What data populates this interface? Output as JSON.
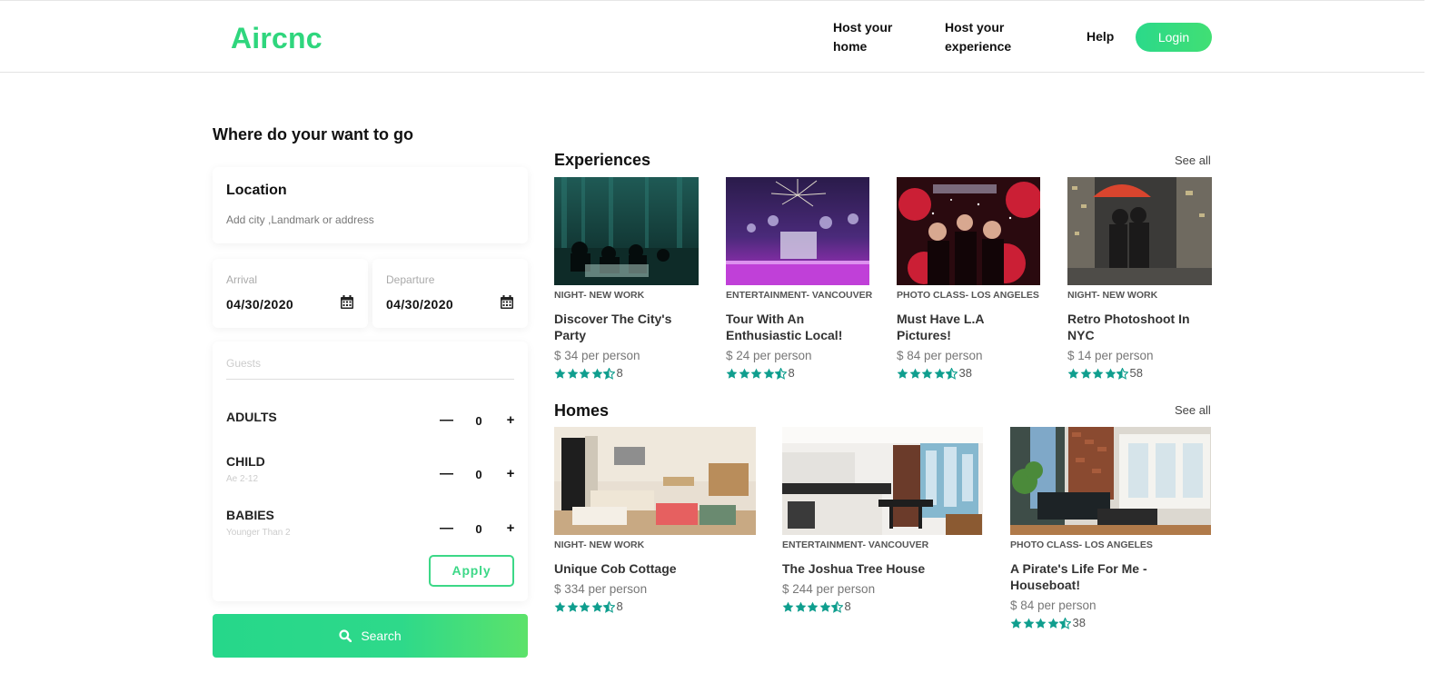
{
  "header": {
    "logo": "Aircnc",
    "nav": {
      "host_home": "Host your home",
      "host_experience": "Host your experience",
      "help": "Help"
    },
    "login": "Login"
  },
  "search_panel": {
    "title": "Where do your want to go",
    "location": {
      "label": "Location",
      "placeholder": "Add city ,Landmark or address"
    },
    "arrival": {
      "label": "Arrival",
      "value": "04/30/2020"
    },
    "departure": {
      "label": "Departure",
      "value": "04/30/2020"
    },
    "guests": {
      "label": "Guests",
      "rows": [
        {
          "title": "ADULTS",
          "subtitle": "",
          "count": "0"
        },
        {
          "title": "CHILD",
          "subtitle": "Ae 2-12",
          "count": "0"
        },
        {
          "title": "BABIES",
          "subtitle": "Younger Than 2",
          "count": "0"
        }
      ],
      "minus": "—",
      "plus": "+",
      "apply": "Apply"
    },
    "search_button": "Search"
  },
  "experiences": {
    "title": "Experiences",
    "see_all": "See all",
    "items": [
      {
        "category": "NIGHT- NEW WORK",
        "title": "Discover The City's Party",
        "price": "$ 34 per person",
        "rating": 4.5,
        "reviews": "8"
      },
      {
        "category": "ENTERTAINMENT- VANCOUVER",
        "title": "Tour With An Enthusiastic Local!",
        "price": "$ 24 per person",
        "rating": 4.5,
        "reviews": "8"
      },
      {
        "category": "PHOTO CLASS- LOS ANGELES",
        "title": "Must Have L.A Pictures!",
        "price": "$ 84 per person",
        "rating": 4.5,
        "reviews": "38"
      },
      {
        "category": "NIGHT- NEW WORK",
        "title": "Retro Photoshoot In NYC",
        "price": "$ 14 per person",
        "rating": 4.5,
        "reviews": "58"
      }
    ]
  },
  "homes": {
    "title": "Homes",
    "see_all": "See all",
    "items": [
      {
        "category": "NIGHT- NEW WORK",
        "title": "Unique Cob Cottage",
        "price": "$ 334 per person",
        "rating": 4.5,
        "reviews": "8"
      },
      {
        "category": "ENTERTAINMENT- VANCOUVER",
        "title": "The Joshua Tree House",
        "price": "$ 244 per person",
        "rating": 4.5,
        "reviews": "8"
      },
      {
        "category": "PHOTO CLASS- LOS ANGELES",
        "title": "A Pirate's Life For Me - Houseboat!",
        "price": "$ 84 per person",
        "rating": 4.5,
        "reviews": "38"
      }
    ]
  },
  "colors": {
    "brand": "#2fd67d",
    "star": "#0f9e8e"
  },
  "icons": {
    "calendar": "calendar-icon",
    "search": "search-icon",
    "star": "star-icon",
    "half_star": "half-star-icon"
  }
}
